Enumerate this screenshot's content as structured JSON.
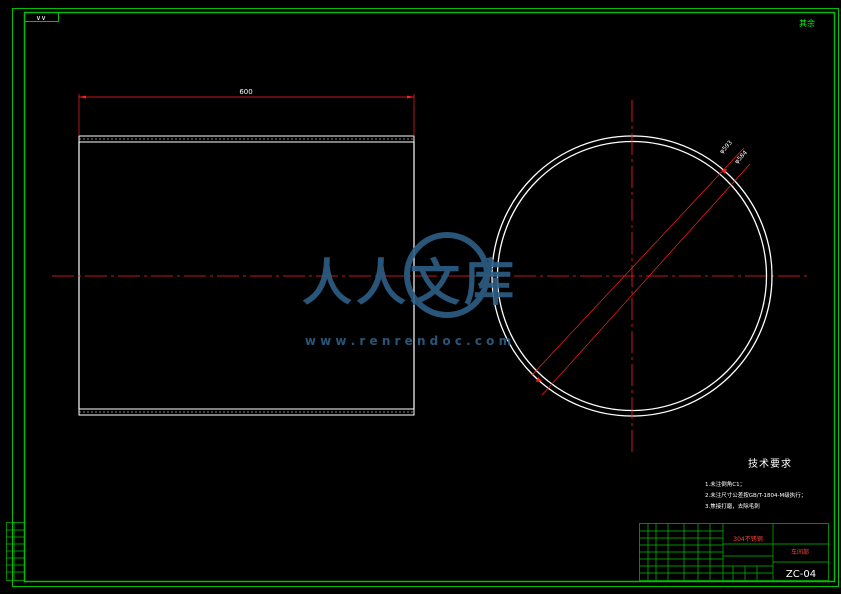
{
  "drawing": {
    "scale_tag": "∨∨",
    "corner_mark": "其余",
    "drawing_number": "ZC-04",
    "material": "304不锈钢",
    "unit_name": "车间部"
  },
  "dimensions": {
    "length": "600",
    "outer_diameter": "φ593",
    "inner_diameter": "φ584"
  },
  "tech_requirements": {
    "title": "技术要求",
    "items": [
      "1.未注倒角C1；",
      "2.未注尺寸公差按GB/T-1804-M级执行；",
      "3.焦接打磨，去除毛刺"
    ]
  },
  "watermark": {
    "text": "人人文库",
    "url": "w w w . r e n r e n d o c . c o m"
  },
  "colors": {
    "background": "#000000",
    "border": "#00c000",
    "part": "#ffffff",
    "centerline": "#ff2020",
    "dimension": "#ff2020",
    "text": "#ffffff",
    "watermark": "#2d5f86"
  }
}
